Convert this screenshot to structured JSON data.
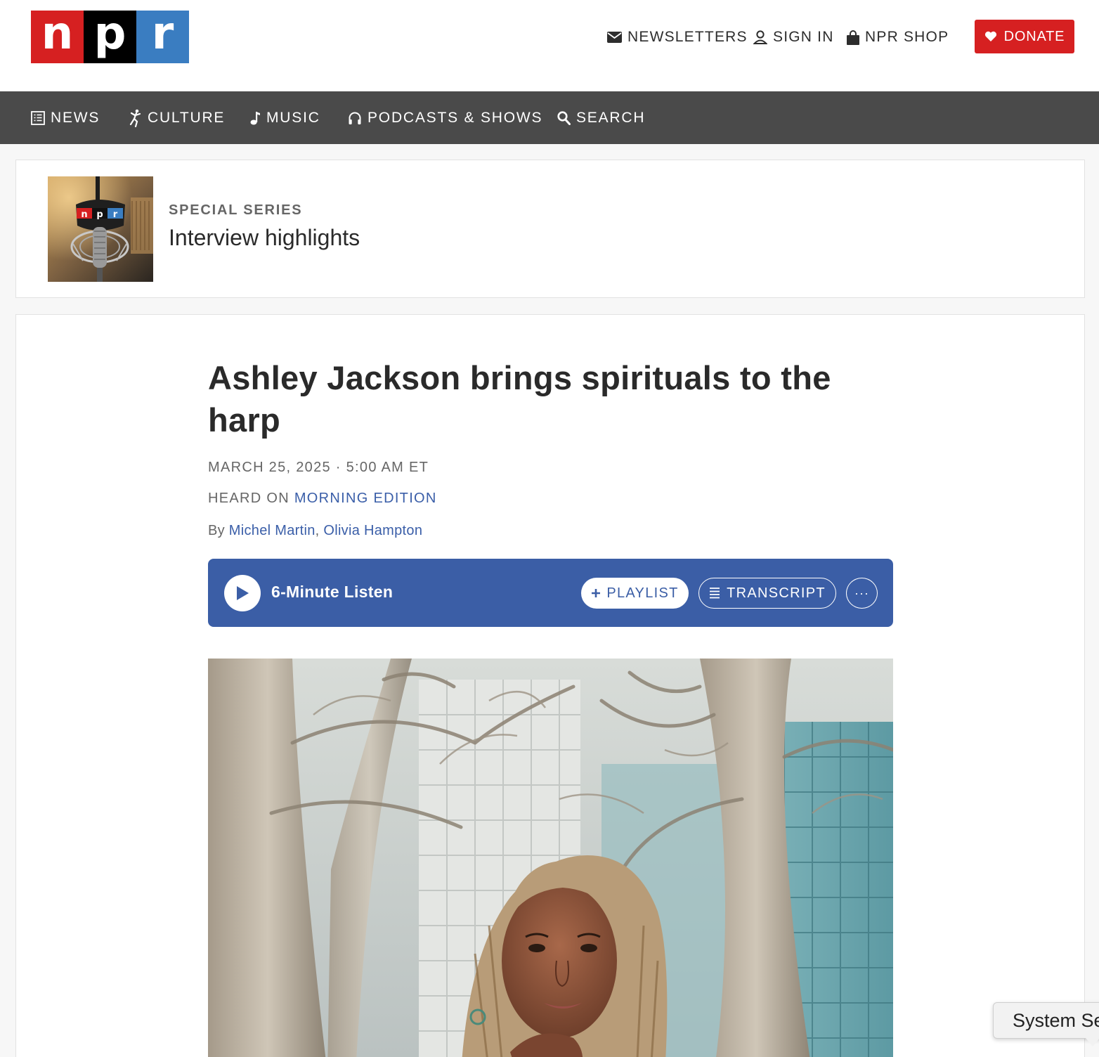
{
  "header": {
    "logo_letters": [
      "n",
      "p",
      "r"
    ],
    "newsletters_label": "NEWSLETTERS",
    "signin_label": "SIGN IN",
    "shop_label": "NPR SHOP",
    "donate_label": "DONATE"
  },
  "nav": {
    "items": [
      {
        "label": "NEWS",
        "icon": "news-icon"
      },
      {
        "label": "CULTURE",
        "icon": "culture-icon"
      },
      {
        "label": "MUSIC",
        "icon": "music-note-icon"
      },
      {
        "label": "PODCASTS & SHOWS",
        "icon": "headphones-icon"
      },
      {
        "label": "SEARCH",
        "icon": "search-icon"
      }
    ]
  },
  "series": {
    "eyebrow": "SPECIAL SERIES",
    "title": "Interview highlights",
    "thumb_logo_text": "n p r"
  },
  "article": {
    "headline": "Ashley Jackson brings spirituals to the harp",
    "dateline": "MARCH 25, 2025 · 5:00 AM ET",
    "heard_prefix": "HEARD ON ",
    "heard_show": "MORNING EDITION",
    "byline_prefix": "By ",
    "authors": [
      "Michel Martin",
      "Olivia Hampton"
    ],
    "author_separator": ", "
  },
  "player": {
    "listen_label": "6-Minute Listen",
    "playlist_label": "PLAYLIST",
    "transcript_label": "TRANSCRIPT",
    "more_label": "···"
  },
  "tooltip": {
    "text": "System Se"
  },
  "colors": {
    "npr_red": "#d62021",
    "npr_black": "#000000",
    "npr_blue": "#3a7dc1",
    "nav_bg": "#4a4a4a",
    "player_bg": "#3b5ea6",
    "link": "#3a5ea8"
  }
}
